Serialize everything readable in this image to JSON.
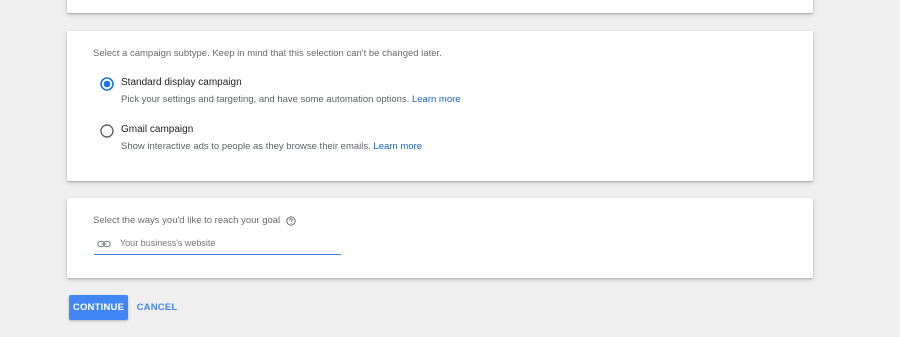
{
  "subtype_section": {
    "prompt": "Select a campaign subtype. Keep in mind that this selection can't be changed later.",
    "options": [
      {
        "title": "Standard display campaign",
        "description": "Pick your settings and targeting, and have some automation options.",
        "link": "Learn more",
        "selected": true
      },
      {
        "title": "Gmail campaign",
        "description": "Show interactive ads to people as they browse their emails.",
        "link": "Learn more",
        "selected": false
      }
    ]
  },
  "goal_section": {
    "prompt": "Select the ways you'd like to reach your goal",
    "help_icon": "help-circle-icon",
    "website_field": {
      "icon": "link-icon",
      "placeholder": "Your business's website",
      "value": ""
    }
  },
  "actions": {
    "continue_label": "CONTINUE",
    "cancel_label": "CANCEL"
  },
  "colors": {
    "accent": "#4285f4",
    "link": "#1a66c9",
    "background": "#efefef",
    "card": "#ffffff"
  }
}
